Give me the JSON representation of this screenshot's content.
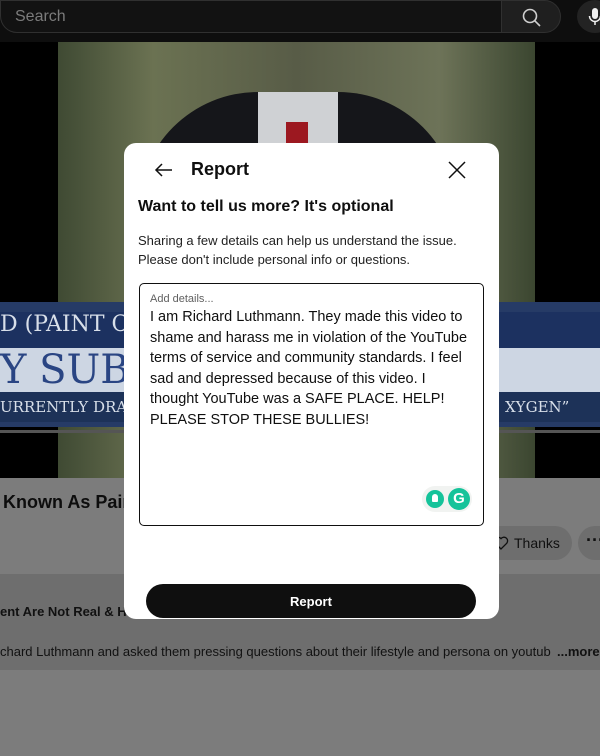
{
  "search": {
    "placeholder": "Search"
  },
  "video": {
    "chyron_line1": "D (PAINT CH",
    "chyron_line2": "Y SUBPO",
    "chyron_line3": "URRENTLY DRAF",
    "chyron_right": "XYGEN”"
  },
  "page": {
    "video_title": "Known As Pain",
    "thanks_label": "Thanks",
    "more_actions_label": "···",
    "desc_heading": "ent Are Not Real & Ha",
    "desc_body": "chard Luthmann and asked them pressing questions about their lifestyle and persona on youtub",
    "desc_more": "...more"
  },
  "modal": {
    "title": "Report",
    "heading": "Want to tell us more? It's optional",
    "hint": "Sharing a few details can help us understand the issue. Please don't include personal info or questions.",
    "details_label": "Add details...",
    "details_text": "I am Richard Luthmann. They made this video to shame and harass me in violation of the YouTube terms of service and community standards. I feel sad and depressed because of this video. I thought YouTube was a SAFE PLACE. HELP! PLEASE STOP THESE BULLIES!",
    "report_button": "Report"
  }
}
